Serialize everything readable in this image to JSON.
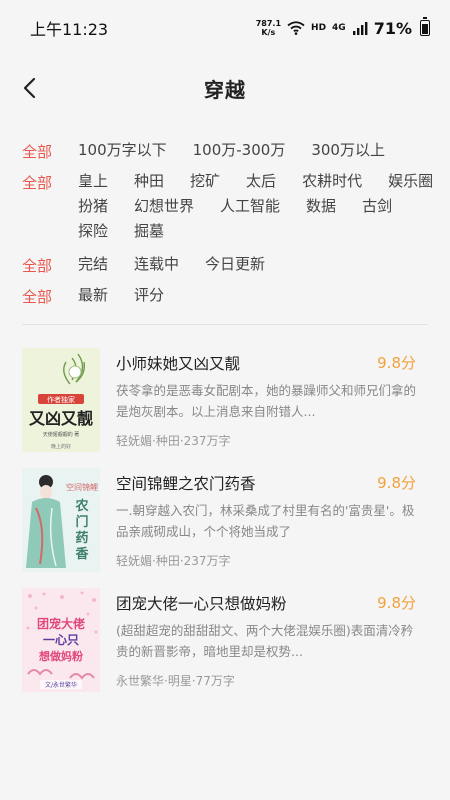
{
  "status_bar": {
    "time": "上午11:23",
    "net_speed_value": "787.1",
    "net_speed_unit": "K/s",
    "hd_label": "HD",
    "network_label": "4G",
    "battery_percent": "71%",
    "battery_level": 0.71
  },
  "header": {
    "title": "穿越"
  },
  "filters": {
    "rows": [
      {
        "all": "全部",
        "options": [
          "100万字以下",
          "100万-300万",
          "300万以上"
        ]
      },
      {
        "all": "全部",
        "options": [
          "皇上",
          "种田",
          "挖矿",
          "太后",
          "农耕时代",
          "娱乐圈",
          "扮猪",
          "幻想世界",
          "人工智能",
          "数据",
          "古剑",
          "探险",
          "掘墓"
        ]
      },
      {
        "all": "全部",
        "options": [
          "完结",
          "连载中",
          "今日更新"
        ]
      },
      {
        "all": "全部",
        "options": [
          "最新",
          "评分"
        ]
      }
    ]
  },
  "books": [
    {
      "title": "小师妹她又凶又靓",
      "score": "9.8分",
      "description": "茯苓拿的是恶毒女配剧本，她的暴躁师父和师兄们拿的是炮灰剧本。以上消息来自附错人...",
      "meta": "轻妩媚·种田·237万字",
      "cover": {
        "badge": "作者独家",
        "big_text": "又凶又靓",
        "author": "天使姬靓靓的 著",
        "publisher": "晚上的好",
        "palette": [
          "#eef3dc",
          "#5a8a3a",
          "#222222"
        ]
      }
    },
    {
      "title": "空间锦鲤之农门药香",
      "score": "9.8分",
      "description": "一.朝穿越入农门，林采桑成了村里有名的'富贵星'。极品亲戚砌成山，个个将她当成了",
      "meta": "轻妩媚·种田·237万字",
      "cover": {
        "big_text": "农门药香",
        "sub_text": "空间锦鲤",
        "palette": [
          "#e9f3f1",
          "#3e7f6d",
          "#d26a6a"
        ]
      }
    },
    {
      "title": "团宠大佬一心只想做妈粉",
      "score": "9.8分",
      "description": "(超甜超宠的甜甜甜文、两个大佬混娱乐圈)表面清冷矜贵的新晋影帝，暗地里却是权势...",
      "meta": "永世繁华·明星·77万字",
      "cover": {
        "big_text": "团宠大佬一心只想做妈粉",
        "author": "文/永世繁华",
        "palette": [
          "#fbe8ee",
          "#e0487c",
          "#5a3fa0"
        ]
      }
    }
  ]
}
